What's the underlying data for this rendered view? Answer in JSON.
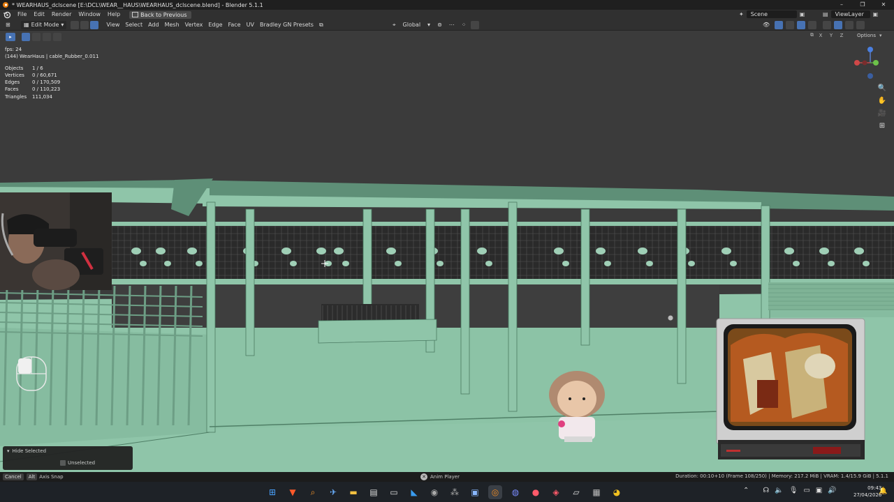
{
  "titlebar": {
    "title": "* WEARHAUS_dclscene [E:\\DCL\\WEAR__HAUS\\WEARHAUS_dclscene.blend] - Blender 5.1.1",
    "minimize": "–",
    "maximize": "❐",
    "close": "✕"
  },
  "menubar": {
    "items": [
      "File",
      "Edit",
      "Render",
      "Window",
      "Help"
    ],
    "back_button": "Back to Previous",
    "scene": "Scene",
    "view_layer": "ViewLayer"
  },
  "editor_header": {
    "mode": "Edit Mode",
    "menus": [
      "View",
      "Select",
      "Add",
      "Mesh",
      "Vertex",
      "Edge",
      "Face",
      "UV",
      "Bradley GN Presets"
    ],
    "orientation": "Global",
    "options_label": "Options"
  },
  "viewport": {
    "fps": "fps: 24",
    "active_object": "(144) WearHaus | cable_Rubber_0.011",
    "stats": [
      {
        "label": "Objects",
        "value": "1 / 6"
      },
      {
        "label": "Vertices",
        "value": "0 / 60,671"
      },
      {
        "label": "Edges",
        "value": "0 / 170,509"
      },
      {
        "label": "Faces",
        "value": "0 / 110,223"
      },
      {
        "label": "Triangles",
        "value": "111,034"
      }
    ],
    "axes": [
      "X",
      "Y",
      "Z"
    ],
    "colors": {
      "mesh": "#8fc5a9",
      "mesh_dark": "#5e8f77",
      "wire": "#1a1a1a",
      "background": "#3b3b3b"
    }
  },
  "operator_panel": {
    "title": "Hide Selected",
    "option": "Unselected"
  },
  "statusbar": {
    "cancel_key": "Cancel",
    "alt_key": "Alt",
    "axis_snap": "Axis Snap",
    "anim_player": "Anim Player",
    "info": "Duration: 00:10+10 (Frame 108/250) | Memory: 217.2 MiB | VRAM: 1.4/15.9 GiB | 5.1.1"
  },
  "taskbar": {
    "time": "09:43",
    "date": "27/04/2026"
  }
}
